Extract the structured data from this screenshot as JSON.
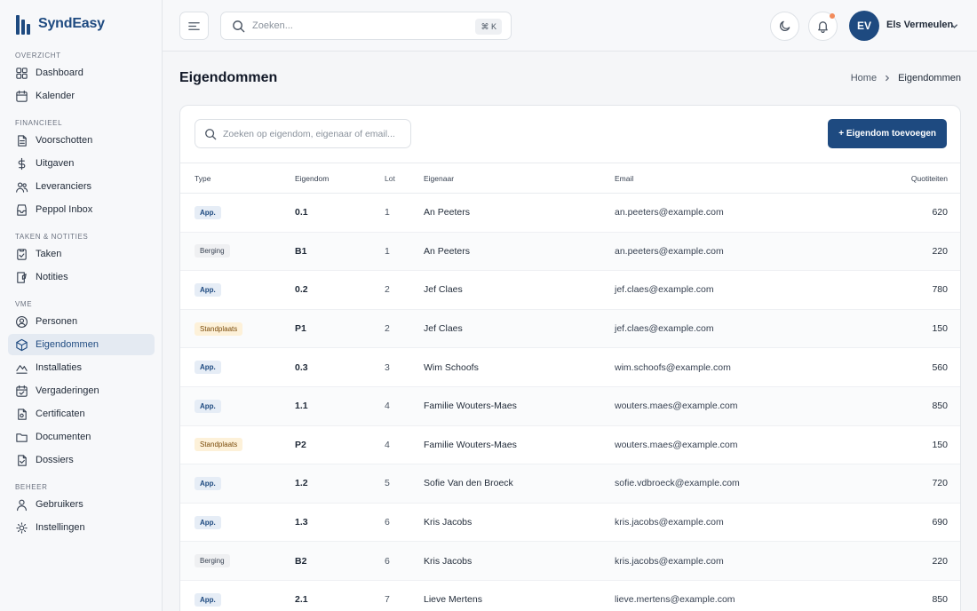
{
  "app": {
    "name": "SyndEasy"
  },
  "colors": {
    "primary": "#1e4a80",
    "notification": "#f28b5b",
    "active_bg": "#e4eaf2"
  },
  "sidebar": {
    "sections": [
      {
        "label": "OVERZICHT",
        "items": [
          {
            "label": "Dashboard",
            "icon": "dashboard-icon"
          },
          {
            "label": "Kalender",
            "icon": "calendar-icon"
          }
        ]
      },
      {
        "label": "FINANCIEEL",
        "items": [
          {
            "label": "Voorschotten",
            "icon": "document-icon"
          },
          {
            "label": "Uitgaven",
            "icon": "dollar-icon"
          },
          {
            "label": "Leveranciers",
            "icon": "users-icon"
          },
          {
            "label": "Peppol Inbox",
            "icon": "inbox-icon"
          }
        ]
      },
      {
        "label": "TAKEN & NOTITIES",
        "items": [
          {
            "label": "Taken",
            "icon": "task-icon"
          },
          {
            "label": "Notities",
            "icon": "note-icon"
          }
        ]
      },
      {
        "label": "VME",
        "items": [
          {
            "label": "Personen",
            "icon": "person-icon"
          },
          {
            "label": "Eigendommen",
            "icon": "cube-icon",
            "active": true
          },
          {
            "label": "Installaties",
            "icon": "installation-icon"
          },
          {
            "label": "Vergaderingen",
            "icon": "meeting-icon"
          },
          {
            "label": "Certificaten",
            "icon": "certificate-icon"
          },
          {
            "label": "Documenten",
            "icon": "folder-icon"
          },
          {
            "label": "Dossiers",
            "icon": "dossier-icon"
          }
        ]
      },
      {
        "label": "BEHEER",
        "items": [
          {
            "label": "Gebruikers",
            "icon": "user-icon"
          },
          {
            "label": "Instellingen",
            "icon": "settings-icon"
          }
        ]
      }
    ]
  },
  "topbar": {
    "search_placeholder": "Zoeken...",
    "shortcut": "⌘ K",
    "user": {
      "initials": "EV",
      "name": "Els Vermeulen"
    }
  },
  "page": {
    "title": "Eigendommen",
    "breadcrumb": {
      "home": "Home",
      "current": "Eigendommen"
    }
  },
  "table": {
    "search_placeholder": "Zoeken op eigendom, eigenaar of email...",
    "add_button": "+ Eigendom toevoegen",
    "columns": {
      "type": "Type",
      "property": "Eigendom",
      "lot": "Lot",
      "owner": "Eigenaar",
      "email": "Email",
      "quota": "Quotiteiten"
    },
    "rows": [
      {
        "type": "App.",
        "kind": "app",
        "property": "0.1",
        "lot": "1",
        "owner": "An Peeters",
        "email": "an.peeters@example.com",
        "quota": "620"
      },
      {
        "type": "Berging",
        "kind": "berging",
        "property": "B1",
        "lot": "1",
        "owner": "An Peeters",
        "email": "an.peeters@example.com",
        "quota": "220"
      },
      {
        "type": "App.",
        "kind": "app",
        "property": "0.2",
        "lot": "2",
        "owner": "Jef Claes",
        "email": "jef.claes@example.com",
        "quota": "780"
      },
      {
        "type": "Standplaats",
        "kind": "standplaats",
        "property": "P1",
        "lot": "2",
        "owner": "Jef Claes",
        "email": "jef.claes@example.com",
        "quota": "150"
      },
      {
        "type": "App.",
        "kind": "app",
        "property": "0.3",
        "lot": "3",
        "owner": "Wim Schoofs",
        "email": "wim.schoofs@example.com",
        "quota": "560"
      },
      {
        "type": "App.",
        "kind": "app",
        "property": "1.1",
        "lot": "4",
        "owner": "Familie Wouters-Maes",
        "email": "wouters.maes@example.com",
        "quota": "850"
      },
      {
        "type": "Standplaats",
        "kind": "standplaats",
        "property": "P2",
        "lot": "4",
        "owner": "Familie Wouters-Maes",
        "email": "wouters.maes@example.com",
        "quota": "150"
      },
      {
        "type": "App.",
        "kind": "app",
        "property": "1.2",
        "lot": "5",
        "owner": "Sofie Van den Broeck",
        "email": "sofie.vdbroeck@example.com",
        "quota": "720"
      },
      {
        "type": "App.",
        "kind": "app",
        "property": "1.3",
        "lot": "6",
        "owner": "Kris Jacobs",
        "email": "kris.jacobs@example.com",
        "quota": "690"
      },
      {
        "type": "Berging",
        "kind": "berging",
        "property": "B2",
        "lot": "6",
        "owner": "Kris Jacobs",
        "email": "kris.jacobs@example.com",
        "quota": "220"
      },
      {
        "type": "App.",
        "kind": "app",
        "property": "2.1",
        "lot": "7",
        "owner": "Lieve Mertens",
        "email": "lieve.mertens@example.com",
        "quota": "850"
      }
    ]
  }
}
